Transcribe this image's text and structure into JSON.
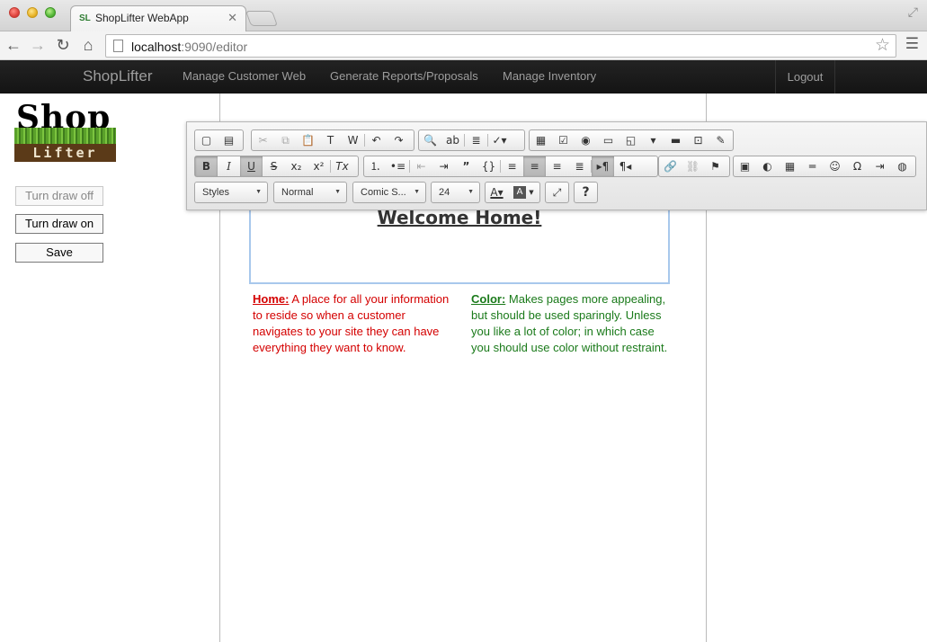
{
  "browser": {
    "tab_title": "ShopLifter WebApp",
    "url_host": "localhost",
    "url_rest": ":9090/editor"
  },
  "navbar": {
    "brand": "ShopLifter",
    "links": [
      "Manage Customer Web",
      "Generate Reports/Proposals",
      "Manage Inventory"
    ],
    "logout": "Logout"
  },
  "logo": {
    "top": "Shop",
    "bottom": "Lifter"
  },
  "sidebar": {
    "buttons": [
      "Turn draw off",
      "Turn draw on",
      "Save"
    ]
  },
  "editor": {
    "toolbar": {
      "styles": "Styles",
      "format": "Normal",
      "font": "Comic S...",
      "size": "24",
      "help": "?"
    },
    "heading": "Welcome Home!",
    "col1_label": "Home:",
    "col1_text": " A place for all your information to reside so when a customer navigates to your site they can have everything they want to know.",
    "col2_label": "Color:",
    "col2_text": " Makes pages more appealing, but should be used sparingly. Unless you like a lot of color; in which case you should use color without restraint."
  },
  "colors": {
    "navbar_bg": "#1b1b1b",
    "home_text": "#d40000",
    "color_text": "#1a7a1a",
    "editor_focus": "#a8c8ec"
  }
}
